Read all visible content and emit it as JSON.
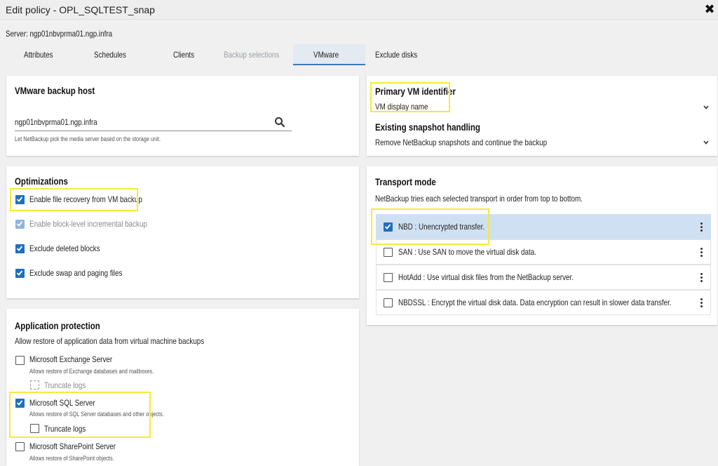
{
  "window": {
    "title": "Edit policy - OPL_SQLTEST_snap",
    "close_glyph": "✖"
  },
  "server_label": "Server: ngp01nbvprma01.ngp.infra",
  "tabs": [
    {
      "label": "Attributes"
    },
    {
      "label": "Schedules"
    },
    {
      "label": "Clients"
    },
    {
      "label": "Backup selections"
    },
    {
      "label": "VMware"
    },
    {
      "label": "Exclude disks"
    }
  ],
  "backup_host": {
    "title": "VMware backup host",
    "value": "ngp01nbvprma01.ngp.infra",
    "helper": "Let NetBackup pick the media server based on the storage unit."
  },
  "vm_identifier": {
    "title": "Primary VM identifier",
    "value": "VM display name",
    "snapshot_title": "Existing snapshot handling",
    "snapshot_value": "Remove NetBackup snapshots and continue the backup"
  },
  "optimizations": {
    "title": "Optimizations",
    "items": [
      {
        "label": "Enable file recovery from VM backup",
        "checked": true
      },
      {
        "label": "Enable block-level incremental backup",
        "checked": true
      },
      {
        "label": "Exclude deleted blocks",
        "checked": true
      },
      {
        "label": "Exclude swap and paging files",
        "checked": true
      }
    ]
  },
  "transport": {
    "title": "Transport mode",
    "description": "NetBackup tries each selected transport in order from top to bottom.",
    "items": [
      {
        "label": "NBD : Unencrypted transfer.",
        "checked": true
      },
      {
        "label": "SAN : Use SAN to move the virtual disk data.",
        "checked": false
      },
      {
        "label": "HotAdd : Use virtual disk files from the NetBackup server.",
        "checked": false
      },
      {
        "label": "NBDSSL : Encrypt the virtual disk data. Data encryption can result in slower data transfer.",
        "checked": false
      }
    ]
  },
  "app_protection": {
    "title": "Application protection",
    "description": "Allow restore of application data from virtual machine backups",
    "exchange": {
      "label": "Microsoft Exchange Server",
      "helper": "Allows restore of Exchange databases and mailboxes.",
      "truncate": "Truncate logs"
    },
    "sql": {
      "label": "Microsoft SQL Server",
      "helper": "Allows restore of SQL Server databases and other objects.",
      "truncate": "Truncate logs"
    },
    "sharepoint": {
      "label": "Microsoft SharePoint Server",
      "helper": "Allows restore of SharePoint objects."
    }
  }
}
